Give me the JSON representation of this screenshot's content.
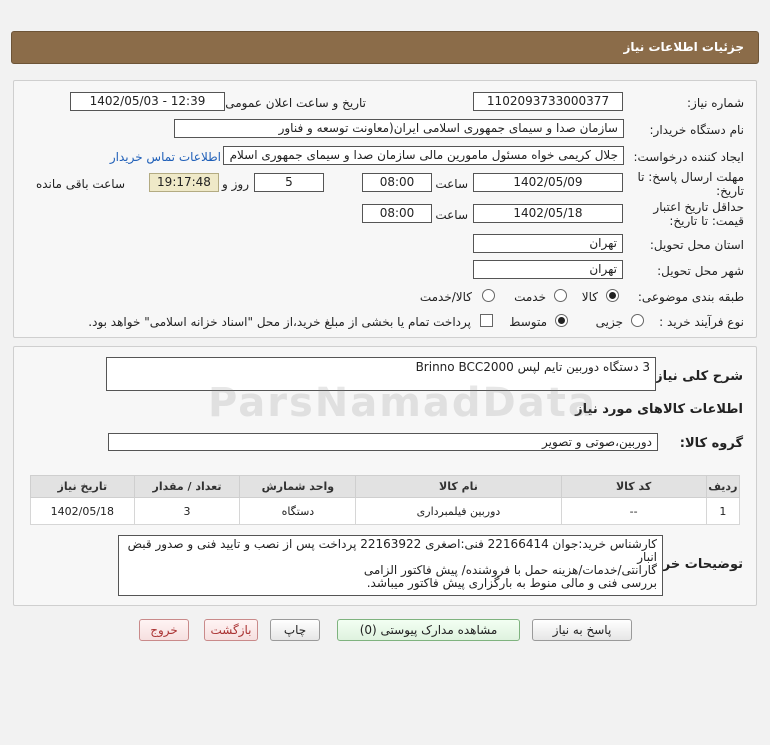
{
  "header": {
    "title": "جزئیات اطلاعات نیاز"
  },
  "form": {
    "need_number_label": "شماره نیاز:",
    "need_number": "1102093733000377",
    "announce_label": "تاریخ و ساعت اعلان عمومی:",
    "announce_value": "1402/05/03 - 12:39",
    "buyer_label": "نام دستگاه خریدار:",
    "buyer_value": "سازمان صدا و سیمای جمهوری اسلامی ایران(معاونت توسعه و فناور",
    "requester_label": "ایجاد کننده درخواست:",
    "requester_value": "جلال کریمی خواه مسئول مامورین مالی  سازمان صدا و سیمای جمهوری اسلام",
    "contact_link": "اطلاعات تماس خریدار",
    "deadline_label_1": "مهلت ارسال پاسخ: تا",
    "deadline_label_2": "تاریخ:",
    "deadline_date": "1402/05/09",
    "time_label": "ساعت",
    "deadline_time": "08:00",
    "days_value": "5",
    "days_label": "روز و",
    "remaining_time": "19:17:48",
    "remaining_label": "ساعت باقی مانده",
    "validity_label_1": "حداقل تاریخ اعتبار",
    "validity_label_2": "قیمت: تا تاریخ:",
    "validity_date": "1402/05/18",
    "validity_time": "08:00",
    "province_label": "استان محل تحویل:",
    "province_value": "تهران",
    "city_label": "شهر محل تحویل:",
    "city_value": "تهران",
    "category_label": "طبقه بندی موضوعی:",
    "category_options": [
      "کالا",
      "خدمت",
      "کالا/خدمت"
    ],
    "process_label": "نوع فرآیند خرید :",
    "process_options": [
      "جزیی",
      "متوسط"
    ],
    "payment_note": "پرداخت تمام یا بخشی از مبلغ خرید،از محل \"اسناد خزانه اسلامی\" خواهد بود."
  },
  "details": {
    "summary_label": "شرح کلی نیاز:",
    "summary_value": "3 دستگاه دوربین تایم لپس  Brinno BCC2000",
    "goods_info_title": "اطلاعات کالاهای مورد نیاز",
    "goods_group_label": "گروه کالا:",
    "goods_group_value": "دوربین،صوتی و تصویر",
    "table": {
      "headers": [
        "ردیف",
        "کد کالا",
        "نام کالا",
        "واحد شمارش",
        "تعداد / مقدار",
        "تاریخ نیاز"
      ],
      "rows": [
        [
          "1",
          "--",
          "دوربین فیلمبرداری",
          "دستگاه",
          "3",
          "1402/05/18"
        ]
      ]
    },
    "buyer_notes_label": "توضیحات خریدار:",
    "buyer_notes": [
      "کارشناس خرید:جوان 22166414   فنی:اصغری 22163922 پرداخت پس از نصب و تایید فنی و صدور قبض انبار",
      "گارانتی/خدمات/هزینه حمل با فروشنده/ پیش فاکتور الزامی",
      "بررسی فنی و مالی منوط به بارگزاری پیش فاکتور میباشد."
    ]
  },
  "buttons": {
    "reply": "پاسخ به نیاز",
    "attachments": "مشاهده مدارک پیوستی (0)",
    "print": "چاپ",
    "back": "بازگشت",
    "exit": "خروج"
  },
  "watermark": {
    "brand": "ParsNamadData"
  }
}
